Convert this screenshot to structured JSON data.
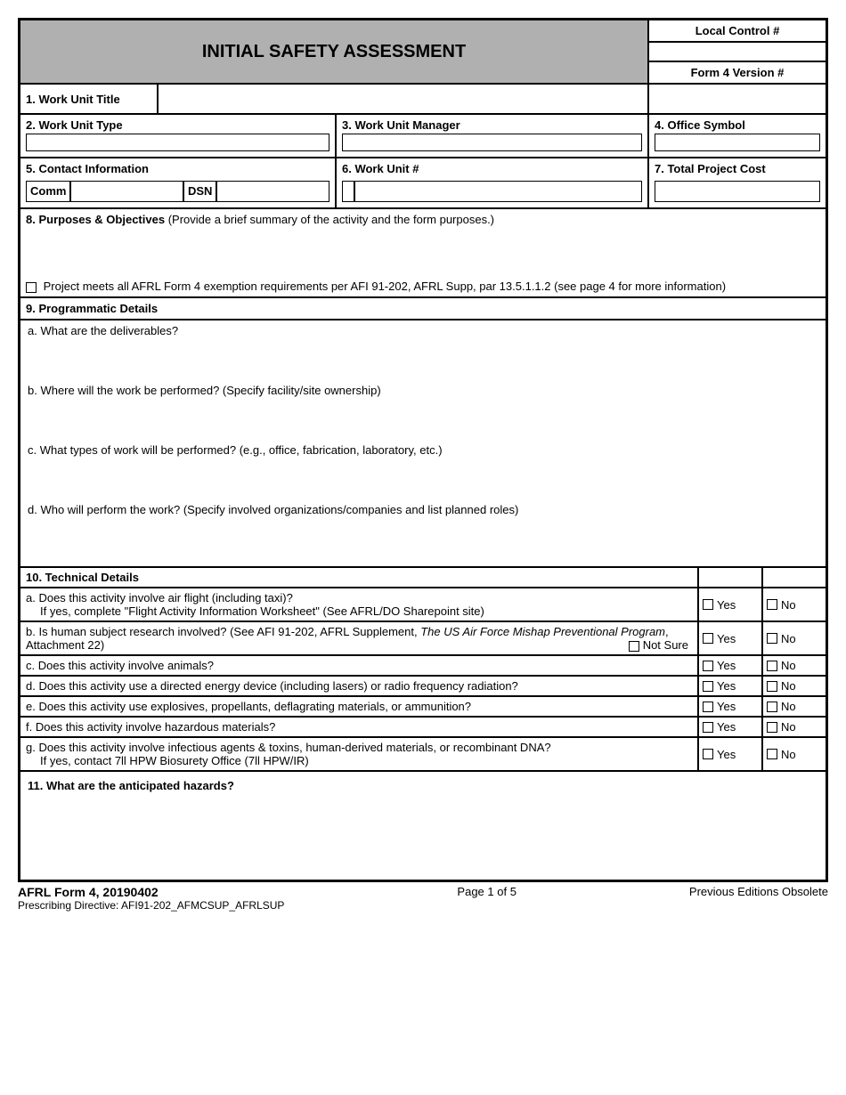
{
  "header": {
    "title": "INITIAL SAFETY ASSESSMENT",
    "local_control": "Local Control #",
    "form_version": "Form 4 Version #"
  },
  "fields": {
    "f1": "1.  Work Unit Title",
    "f2": "2.  Work Unit Type",
    "f3": "3. Work Unit Manager",
    "f4": "4.  Office Symbol",
    "f5": "5.  Contact Information",
    "f5_comm": "Comm",
    "f5_dsn": "DSN",
    "f6": "6.  Work Unit #",
    "f7": "7.  Total Project Cost",
    "f8_label": "8.  Purposes & Objectives",
    "f8_hint": " (Provide a brief summary of the activity and the form purposes.)",
    "f8_exempt": "Project meets all AFRL Form 4 exemption requirements per AFI 91-202, AFRL Supp, par 13.5.1.1.2 (see page 4 for more information)",
    "f9": "9.  Programmatic Details",
    "f9a": "a.  What are the deliverables?",
    "f9b": "b. Where will the work be performed?  (Specify facility/site ownership)",
    "f9c": "c.  What types of work will be performed?  (e.g., office, fabrication, laboratory, etc.)",
    "f9d": "d.  Who will perform the work? (Specify involved organizations/companies and list planned roles)",
    "f10": "10.  Technical Details",
    "f11": "11. What are the anticipated hazards?"
  },
  "tech": {
    "a1": "a.  Does this activity involve air flight (including taxi)?",
    "a2": "If yes, complete \"Flight Activity Information Worksheet\" (See AFRL/DO Sharepoint site)",
    "b1": "b.  Is human subject research involved?  (See AFI 91-202, AFRL Supplement, ",
    "b1_italic": "The US Air Force Mishap Preventional Program",
    "b1_tail": ", Attachment 22)",
    "b_not_sure": "Not Sure",
    "c": "c.  Does this activity involve animals?",
    "d": "d.  Does this activity use a directed energy device (including lasers) or radio frequency radiation?",
    "e": "e.  Does this activity use explosives, propellants, deflagrating materials, or ammunition?",
    "f": "f.   Does this activity involve hazardous materials?",
    "g1": "g.  Does this activity involve infectious agents & toxins, human-derived materials, or recombinant DNA?",
    "g2": "If yes, contact 7ll HPW Biosurety Office (7ll HPW/IR)",
    "yes": "Yes",
    "no": "No"
  },
  "footer": {
    "form_id": "AFRL Form 4, 20190402",
    "directive": "Prescribing Directive:  AFI91-202_AFMCSUP_AFRLSUP",
    "page": "Page 1 of 5",
    "obsolete": "Previous Editions Obsolete"
  }
}
